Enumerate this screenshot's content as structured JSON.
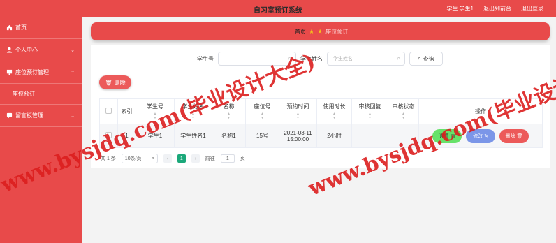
{
  "header": {
    "title": "自习室预订系统",
    "user": "学生 学生1",
    "back_front": "退出到前台",
    "logout": "退出登录"
  },
  "sidebar": {
    "items": [
      {
        "label": "首页",
        "icon": "home-icon"
      },
      {
        "label": "个人中心",
        "icon": "user-icon"
      },
      {
        "label": "座位预订管理",
        "icon": "seat-icon"
      },
      {
        "label": "座位预订",
        "icon": ""
      },
      {
        "label": "留言板管理",
        "icon": "message-icon"
      }
    ]
  },
  "breadcrumb": {
    "home": "首页",
    "current": "座位预订"
  },
  "search": {
    "student_no_label": "学生号",
    "student_name_label": "学生姓名",
    "student_name_placeholder": "学生姓名",
    "query_label": "查询"
  },
  "toolbar": {
    "delete_label": "删除"
  },
  "table": {
    "headers": [
      "索引",
      "学生号",
      "学生姓名",
      "名称",
      "座位号",
      "预约时间",
      "使用时长",
      "审核回复",
      "审核状态",
      "操作"
    ],
    "rows": [
      {
        "index": "1",
        "student_no": "学生1",
        "student_name": "学生姓名1",
        "name": "名称1",
        "seat": "15号",
        "time_date": "2021-03-11",
        "time_clock": "15:00:00",
        "duration": "2小时",
        "reply": "",
        "status": "",
        "detail_label": "详情",
        "edit_label": "修改",
        "delete_label": "删除"
      }
    ]
  },
  "pager": {
    "total": "共 1 条",
    "page_size": "10条/页",
    "page": "1",
    "goto_label": "前往",
    "goto_value": "1",
    "page_suffix": "页"
  },
  "watermark": {
    "text": "www.bysjdq.com(毕业设计大全)"
  },
  "colors": {
    "accent": "#e84a4a",
    "detail": "#67e26a",
    "edit": "#7b96e8",
    "delete": "#ec5a5a",
    "active_page": "#1ba87a"
  }
}
